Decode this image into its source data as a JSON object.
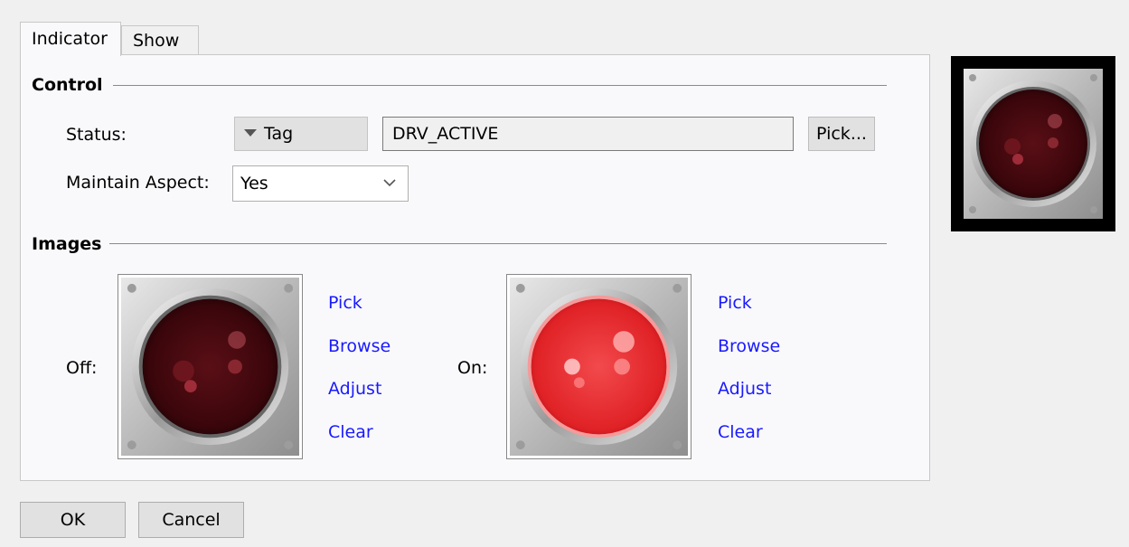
{
  "tabs": [
    {
      "label": "Indicator",
      "active": true
    },
    {
      "label": "Show",
      "active": false
    }
  ],
  "control": {
    "section_title": "Control",
    "status_label": "Status:",
    "status_source": "Tag",
    "status_value": "DRV_ACTIVE",
    "pick_button": "Pick...",
    "aspect_label": "Maintain Aspect:",
    "aspect_value": "Yes"
  },
  "images": {
    "section_title": "Images",
    "off": {
      "label": "Off:",
      "links": [
        "Pick",
        "Browse",
        "Adjust",
        "Clear"
      ]
    },
    "on": {
      "label": "On:",
      "links": [
        "Pick",
        "Browse",
        "Adjust",
        "Clear"
      ]
    }
  },
  "buttons": {
    "ok": "OK",
    "cancel": "Cancel"
  },
  "colors": {
    "link": "#1a1aff",
    "indicator_off": "#4a0a10",
    "indicator_on": "#e8262a"
  },
  "icons": [
    "dropdown-caret-icon",
    "chevron-down-icon",
    "indicator-off-image",
    "indicator-on-image"
  ]
}
